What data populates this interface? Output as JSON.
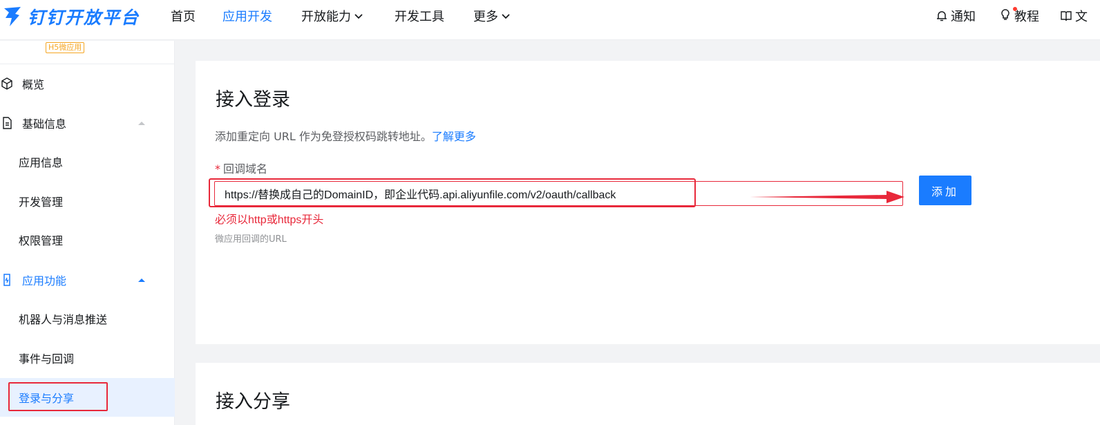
{
  "brand": {
    "name": "钉钉开放平台"
  },
  "nav": {
    "items": [
      {
        "label": "首页"
      },
      {
        "label": "应用开发",
        "active": true
      },
      {
        "label": "开放能力",
        "dropdown": true
      },
      {
        "label": "开发工具"
      },
      {
        "label": "更多",
        "dropdown": true
      }
    ],
    "right": [
      {
        "label": "通知",
        "icon": "bell-icon"
      },
      {
        "label": "教程",
        "icon": "bulb-icon"
      },
      {
        "label": "文",
        "icon": "book-icon"
      }
    ]
  },
  "sidebar": {
    "badge": "H5微应用",
    "items": [
      {
        "label": "概览",
        "icon": "cube-icon"
      },
      {
        "label": "基础信息",
        "icon": "doc-icon",
        "expanded": true
      },
      {
        "label": "应用信息"
      },
      {
        "label": "开发管理"
      },
      {
        "label": "权限管理"
      },
      {
        "label": "应用功能",
        "icon": "phone-icon",
        "expanded": true
      },
      {
        "label": "机器人与消息推送"
      },
      {
        "label": "事件与回调"
      },
      {
        "label": "登录与分享",
        "selected": true
      }
    ]
  },
  "login": {
    "title": "接入登录",
    "desc": "添加重定向 URL 作为免登授权码跳转地址。",
    "learn_more": "了解更多",
    "field_label": "回调域名",
    "required_mark": "*",
    "input_value": "https://替换成自己的DomainID，即企业代码.api.aliyunfile.com/v2/oauth/callback",
    "error": "必须以http或https开头",
    "help": "微应用回调的URL",
    "add_button": "添加"
  },
  "share": {
    "title": "接入分享"
  },
  "colors": {
    "accent": "#1a7cff",
    "error": "#e8283a",
    "annotation": "#e8283a"
  }
}
